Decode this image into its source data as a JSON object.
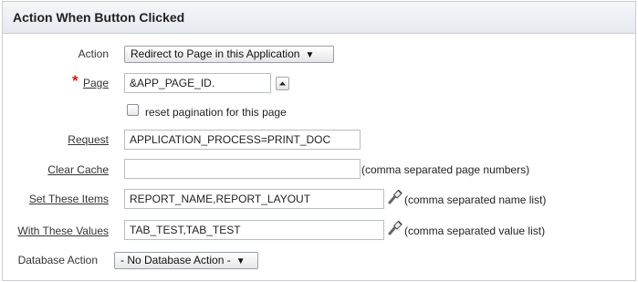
{
  "region": {
    "title": "Action When Button Clicked"
  },
  "form": {
    "action": {
      "label": "Action",
      "value": "Redirect to Page in this Application"
    },
    "page": {
      "label": "Page",
      "value": "&APP_PAGE_ID.",
      "required_mark": "*"
    },
    "reset_pagination": {
      "label": "reset pagination for this page"
    },
    "request": {
      "label": "Request",
      "value": "APPLICATION_PROCESS=PRINT_DOC"
    },
    "clear_cache": {
      "label": "Clear Cache",
      "value": "",
      "hint": "(comma separated page numbers)"
    },
    "set_items": {
      "label": "Set These Items",
      "value": "REPORT_NAME,REPORT_LAYOUT",
      "hint": "(comma separated name list)"
    },
    "with_values": {
      "label": "With These Values",
      "value": "TAB_TEST,TAB_TEST",
      "hint": "(comma separated value list)"
    },
    "database_action": {
      "label": "Database Action",
      "value": "- No Database Action -"
    }
  },
  "icons": {
    "page_lov": "chevron-up-icon",
    "item_picker": "flashlight-icon",
    "value_picker": "flashlight-icon"
  }
}
